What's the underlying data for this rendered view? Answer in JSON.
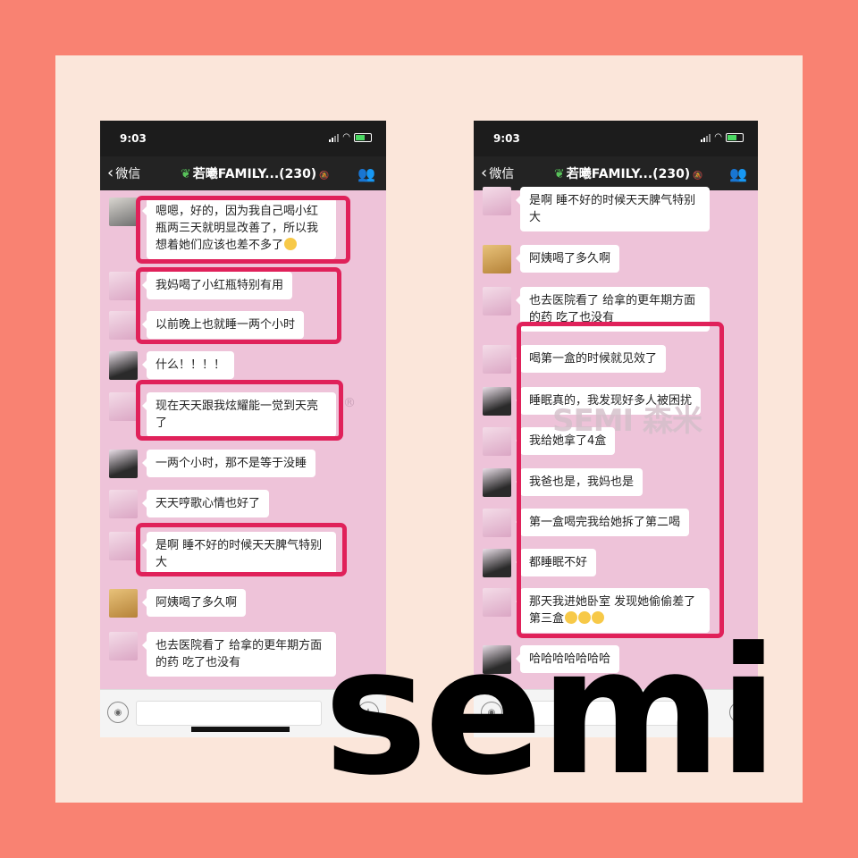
{
  "screens": [
    {
      "status_time": "9:03",
      "back_label": "微信",
      "group_title": "若曦FAMILY...(230)",
      "messages": [
        {
          "avatar": "cap",
          "text": "嗯嗯，好的，因为我自己喝小红瓶两三天就明显改善了，所以我想着她们应该也差不多了"
        },
        {
          "avatar": "light",
          "text": "我妈喝了小红瓶特别有用"
        },
        {
          "avatar": "light",
          "text": "以前晚上也就睡一两个小时"
        },
        {
          "avatar": "dark",
          "text": "什么！！！！"
        },
        {
          "avatar": "light",
          "text": "现在天天跟我炫耀能一觉到天亮了"
        },
        {
          "avatar": "dark",
          "text": "一两个小时，那不是等于没睡"
        },
        {
          "avatar": "light",
          "text": "天天哼歌心情也好了"
        },
        {
          "avatar": "light",
          "text": "是啊 睡不好的时候天天脾气特别大"
        },
        {
          "avatar": "dog",
          "text": "阿姨喝了多久啊"
        },
        {
          "avatar": "light",
          "text": "也去医院看了 给拿的更年期方面的药 吃了也没有"
        }
      ]
    },
    {
      "status_time": "9:03",
      "back_label": "微信",
      "group_title": "若曦FAMILY...(230)",
      "messages": [
        {
          "avatar": "light",
          "text": "是啊 睡不好的时候天天脾气特别大"
        },
        {
          "avatar": "dog",
          "text": "阿姨喝了多久啊"
        },
        {
          "avatar": "light",
          "text": "也去医院看了 给拿的更年期方面的药 吃了也没有"
        },
        {
          "avatar": "light",
          "text": "喝第一盒的时候就见效了"
        },
        {
          "avatar": "dark",
          "text": "睡眠真的，我发现好多人被困扰"
        },
        {
          "avatar": "light",
          "text": "我给她拿了4盒"
        },
        {
          "avatar": "dark",
          "text": "我爸也是，我妈也是"
        },
        {
          "avatar": "light",
          "text": "第一盒喝完我给她拆了第二喝"
        },
        {
          "avatar": "dark",
          "text": "都睡眠不好"
        },
        {
          "avatar": "light",
          "text": "那天我进她卧室 发现她偷偷差了第三盒"
        },
        {
          "avatar": "dark",
          "text": "哈哈哈哈哈哈哈"
        }
      ]
    }
  ],
  "registered_mark": "®",
  "watermark_text": "SEMI 森米",
  "overlay_brand": "semi",
  "colors": {
    "background": "#f98272",
    "card": "#fbe6da",
    "chat_bg": "#eec3d9",
    "highlight": "#e0215a"
  },
  "icons": [
    "back-chevron-icon",
    "leaf-icon",
    "mute-icon",
    "group-members-icon",
    "signal-icon",
    "wifi-icon",
    "battery-icon",
    "voice-icon",
    "plus-icon"
  ]
}
